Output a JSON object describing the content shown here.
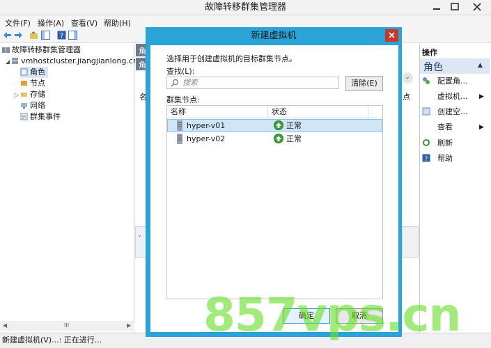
{
  "app": {
    "title": "故障转移群集管理器"
  },
  "menu": [
    "文件(F)",
    "操作(A)",
    "查看(V)",
    "帮助(H)"
  ],
  "tree": {
    "root": "故障转移群集管理器",
    "cluster": "vmhostcluster.jiangjianlong.cn",
    "children": [
      "角色",
      "节点",
      "存储",
      "网络",
      "群集事件"
    ]
  },
  "middle": {
    "fragments": [
      "角",
      "角",
      "名",
      "点"
    ]
  },
  "actions": {
    "header": "操作",
    "section": "角色",
    "items": [
      "配置角...",
      "虚拟机...",
      "创建空...",
      "查看",
      "刷新",
      "帮助"
    ]
  },
  "status": "新建虚拟机(V)...: 正在进行...",
  "dialog": {
    "title": "新建虚拟机",
    "instruction": "选择用于创建虚拟机的目标群集节点。",
    "find_label": "查找(L):",
    "search_placeholder": "搜索",
    "clear_button": "清除(E)",
    "nodes_label": "群集节点:",
    "columns": [
      "名称",
      "状态"
    ],
    "rows": [
      {
        "name": "hyper-v01",
        "status": "正常",
        "selected": true
      },
      {
        "name": "hyper-v02",
        "status": "正常",
        "selected": false
      }
    ],
    "ok_button": "确定",
    "cancel_button": "取消"
  },
  "watermark": "857vps.cn",
  "colors": {
    "accent": "#2aa3d8",
    "close": "#c8382b",
    "selection": "#cfe6f7",
    "ok_green": "#3aa13a"
  }
}
